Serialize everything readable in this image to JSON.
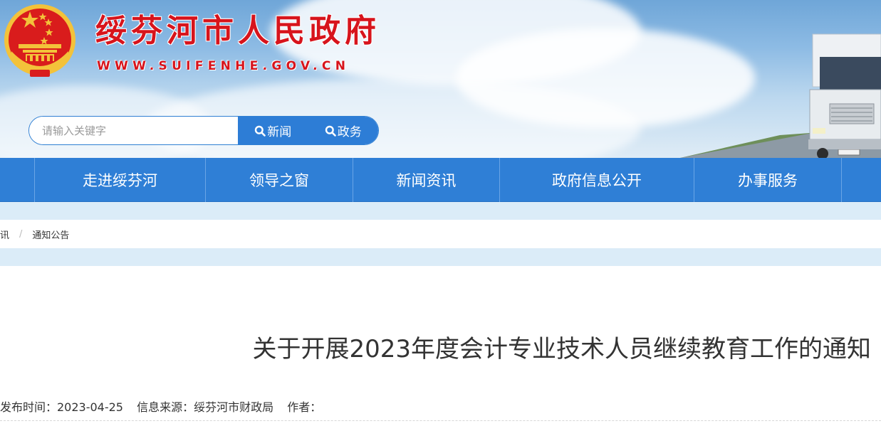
{
  "header": {
    "site_title": "绥芬河市人民政府",
    "site_url": "WWW.SUIFENHE.GOV.CN",
    "emblem_icon": "national-emblem-icon",
    "title_color": "#d7141c"
  },
  "search": {
    "placeholder": "请输入关键字",
    "value": "",
    "buttons": [
      {
        "label": "新闻",
        "icon": "search-icon"
      },
      {
        "label": "政务",
        "icon": "search-icon"
      }
    ],
    "accent_color": "#2d7dd6"
  },
  "nav": {
    "items": [
      {
        "label": "走进绥芬河"
      },
      {
        "label": "领导之窗"
      },
      {
        "label": "新闻资讯"
      },
      {
        "label": "政府信息公开"
      },
      {
        "label": "办事服务"
      }
    ],
    "background_color": "#2f7fd6"
  },
  "breadcrumb": {
    "items": [
      {
        "label": "讯"
      },
      {
        "label": "通知公告"
      }
    ],
    "separator": "/"
  },
  "article": {
    "title": "关于开展2023年度会计专业技术人员继续教育工作的通知",
    "meta": {
      "publish_time": "发布时间：2023-04-25",
      "source": "信息来源：绥芬河市财政局",
      "author": "作者："
    }
  }
}
